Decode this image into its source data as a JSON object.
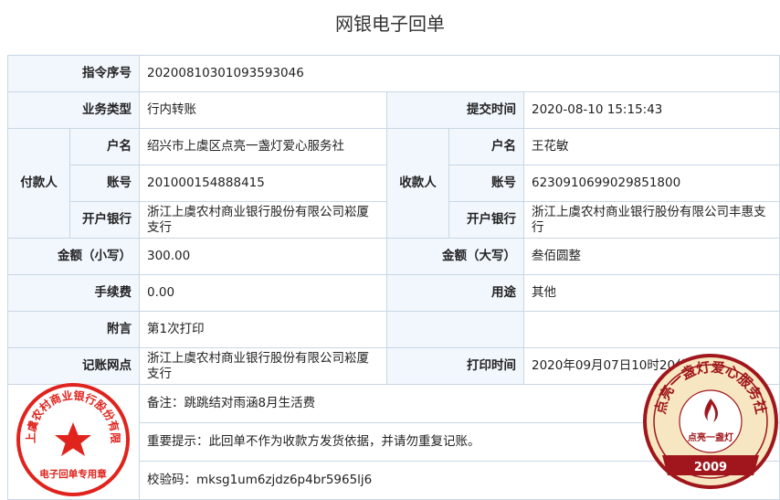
{
  "title": "网银电子回单",
  "rows": {
    "instruction_no": {
      "label": "指令序号",
      "value": "20200810301093593046"
    },
    "business_type": {
      "label": "业务类型",
      "value": "行内转账"
    },
    "submit_time": {
      "label": "提交时间",
      "value": "2020-08-10 15:15:43"
    },
    "payer": {
      "group_label": "付款人",
      "name_label": "户名",
      "name": "绍兴市上虞区点亮一盏灯爱心服务社",
      "account_label": "账号",
      "account": "201000154888415",
      "bank_label": "开户银行",
      "bank": "浙江上虞农村商业银行股份有限公司崧厦支行"
    },
    "payee": {
      "group_label": "收款人",
      "name_label": "户名",
      "name": "王花敏",
      "account_label": "账号",
      "account": "6230910699029851800",
      "bank_label": "开户银行",
      "bank": "浙江上虞农村商业银行股份有限公司丰惠支行"
    },
    "amount_small": {
      "label": "金额（小写）",
      "value": "300.00"
    },
    "amount_big": {
      "label": "金额（大写）",
      "value": "叁佰圆整"
    },
    "fee": {
      "label": "手续费",
      "value": "0.00"
    },
    "purpose": {
      "label": "用途",
      "value": "其他"
    },
    "note": {
      "label": "附言",
      "value": "第1次打印"
    },
    "branch": {
      "label": "记账网点",
      "value": "浙江上虞农村商业银行股份有限公司崧厦支行"
    },
    "print_time": {
      "label": "打印时间",
      "value": "2020年09月07日10时20分"
    }
  },
  "remark": "备注：跳跳结对雨涵8月生活费",
  "notice": "重要提示：此回单不作为收款方发货依据，并请勿重复记账。",
  "check_code": "校验码：mksg1um6zjdz6p4br5965lj6",
  "seals": {
    "bank_seal": {
      "ring_text": "浙江上虞农村商业银行股份有限公司",
      "bottom_text": "电子回单专用章",
      "color": "#e0231c"
    },
    "org_seal": {
      "ring_text": "点亮一盏灯爱心服务社",
      "center_text": "点亮一盏灯",
      "year": "2009",
      "color": "#a0161c"
    }
  }
}
